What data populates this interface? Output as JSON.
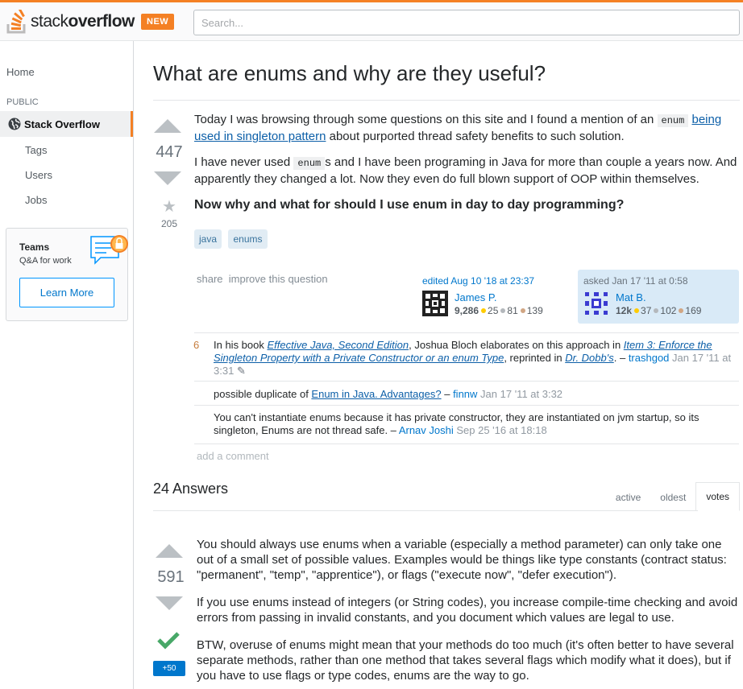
{
  "header": {
    "logo_word_light": "stack",
    "logo_word_bold": "overflow",
    "new_badge": "NEW",
    "search_placeholder": "Search..."
  },
  "sidebar": {
    "home": "Home",
    "public_heading": "PUBLIC",
    "stack_overflow": "Stack Overflow",
    "tags": "Tags",
    "users": "Users",
    "jobs": "Jobs",
    "teams_title": "Teams",
    "teams_sub": "Q&A for work",
    "learn_more": "Learn More"
  },
  "question": {
    "title": "What are enums and why are they useful?",
    "votes": "447",
    "favorites": "205",
    "p1_a": "Today I was browsing through some questions on this site and I found a mention of an ",
    "p1_code": "enum",
    "p1_link": "being used in singleton pattern",
    "p1_b": " about purported thread safety benefits to such solution.",
    "p2_a": "I have never used ",
    "p2_code": "enum",
    "p2_b": "s and I have been programing in Java for more than couple a years now. And apparently they changed a lot. Now they even do full blown support of OOP within themselves.",
    "p3": "Now why and what for should I use enum in day to day programming?",
    "tags": [
      "java",
      "enums"
    ],
    "share": "share",
    "improve": "improve this question",
    "edited_label": "edited Aug 10 '18 at 23:37",
    "editor_name": "James P.",
    "editor_rep": "9,286",
    "editor_gold": "25",
    "editor_silver": "81",
    "editor_bronze": "139",
    "asked_label": "asked Jan 17 '11 at 0:58",
    "asker_name": "Mat B.",
    "asker_rep": "12k",
    "asker_gold": "37",
    "asker_silver": "102",
    "asker_bronze": "169"
  },
  "comments": [
    {
      "score": "6",
      "a": "In his book ",
      "link1": "Effective Java, Second Edition",
      "b": ", Joshua Bloch elaborates on this approach in ",
      "link2": "Item 3: Enforce the Singleton Property with a Private Constructor or an enum Type",
      "c": ", reprinted in ",
      "link3": "Dr. Dobb's",
      "d": ". – ",
      "user": "trashgod",
      "date": "Jan 17 '11 at 3:31"
    },
    {
      "a": "possible duplicate of ",
      "link1": "Enum in Java. Advantages?",
      "d": " – ",
      "user": "finnw",
      "date": "Jan 17 '11 at 3:32"
    },
    {
      "a": "You can't instantiate enums because it has private constructor, they are instantiated on jvm startup, so its singleton, Enums are not thread safe. – ",
      "user": "Arnav Joshi",
      "date": "Sep 25 '16 at 18:18"
    }
  ],
  "add_comment": "add a comment",
  "answers": {
    "count_label": "24 Answers",
    "tabs": [
      "active",
      "oldest",
      "votes"
    ],
    "top_votes": "591",
    "bounty": "+50",
    "p1": "You should always use enums when a variable (especially a method parameter) can only take one out of a small set of possible values. Examples would be things like type constants (contract status: \"permanent\", \"temp\", \"apprentice\"), or flags (\"execute now\", \"defer execution\").",
    "p2": "If you use enums instead of integers (or String codes), you increase compile-time checking and avoid errors from passing in invalid constants, and you document which values are legal to use.",
    "p3": "BTW, overuse of enums might mean that your methods do too much (it's often better to have several separate methods, rather than one method that takes several flags which modify what it does), but if you have to use flags or type codes, enums are the way to go."
  },
  "colors": {
    "accent": "#f48024",
    "link": "#0c5fa8",
    "tag_bg": "#e1ecf4",
    "accepted": "#48a868"
  }
}
